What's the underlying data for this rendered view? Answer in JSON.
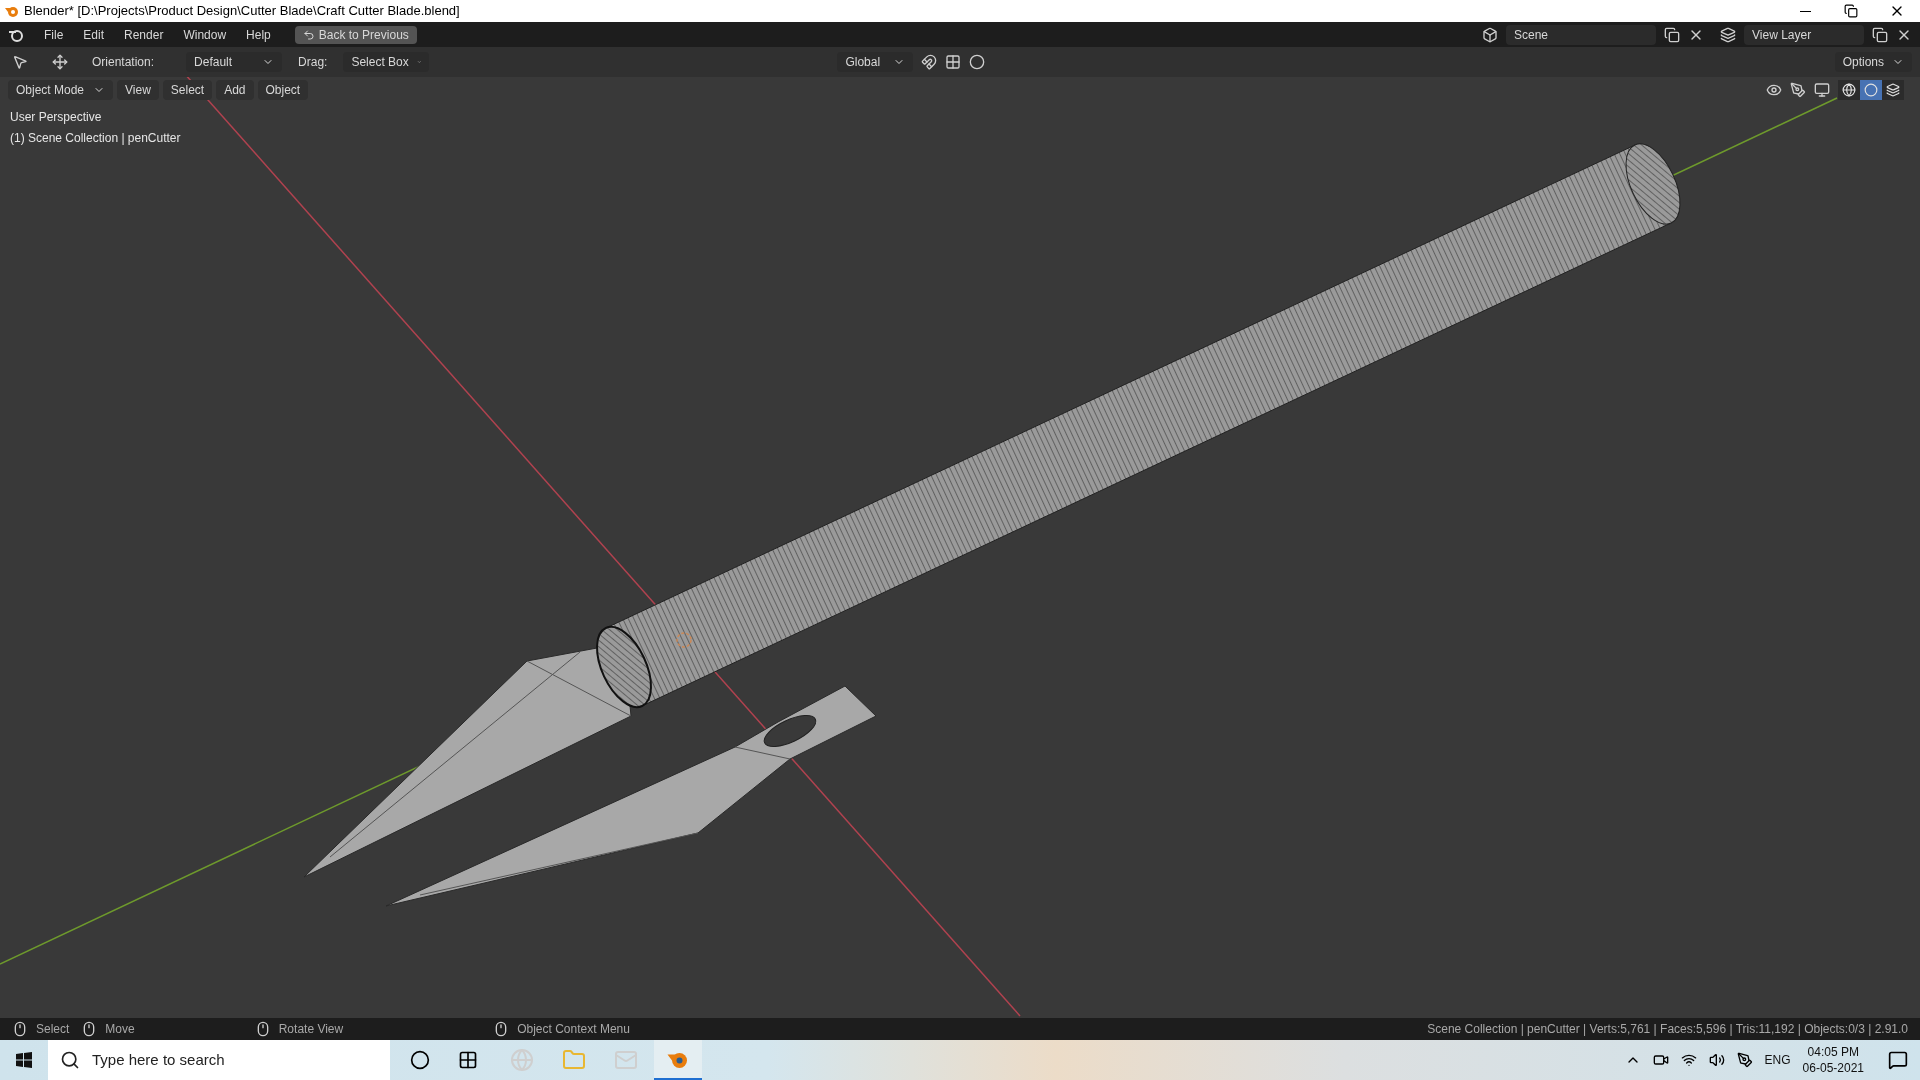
{
  "window": {
    "title": "Blender* [D:\\Projects\\Product Design\\Cutter Blade\\Craft Cutter Blade.blend]"
  },
  "menu": [
    "File",
    "Edit",
    "Render",
    "Window",
    "Help"
  ],
  "back_button": "Back to Previous",
  "scene": {
    "value": "Scene"
  },
  "view_layer": {
    "value": "View Layer"
  },
  "tool_header": {
    "orientation_label": "Orientation:",
    "orientation": "Default",
    "drag_label": "Drag:",
    "drag": "Select Box",
    "transform": "Global",
    "options": "Options"
  },
  "viewport_header": {
    "mode": "Object Mode",
    "menus": [
      "View",
      "Select",
      "Add",
      "Object"
    ],
    "shading_modes": [
      {
        "kind": "wireframe",
        "selected": false
      },
      {
        "kind": "solid",
        "selected": true
      },
      {
        "kind": "material",
        "selected": false
      }
    ]
  },
  "viewport": {
    "perspective": "User Perspective",
    "collection": "(1) Scene Collection | penCutter"
  },
  "status_bar": {
    "hints": [
      "Select",
      "Move",
      "Rotate View",
      "Object Context Menu"
    ],
    "stats": "Scene Collection | penCutter | Verts:5,761 | Faces:5,596 | Tris:11,192 | Objects:0/3 | 2.91.0"
  },
  "taskbar": {
    "search_placeholder": "Type here to search",
    "language": "ENG",
    "time": "04:05 PM",
    "date": "06-05-2021"
  }
}
